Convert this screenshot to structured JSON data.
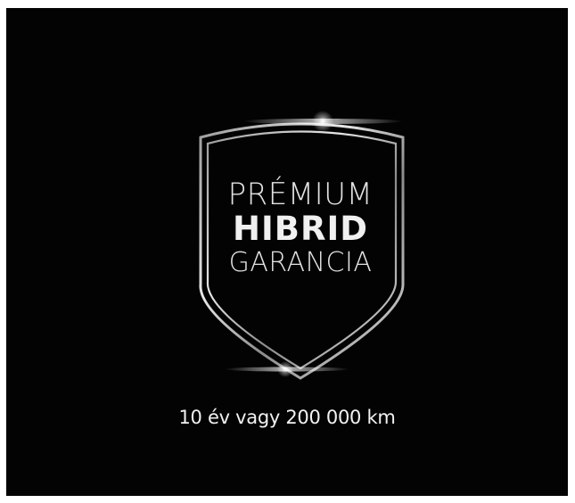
{
  "badge": {
    "line1": "PRÉMIUM",
    "line2": "HIBRID",
    "line3": "GARANCIA"
  },
  "tagline": "10 év vagy 200 000 km",
  "colors": {
    "background": "#030303",
    "foreground": "#e9e9e9"
  },
  "icons": [
    "shield-icon"
  ]
}
